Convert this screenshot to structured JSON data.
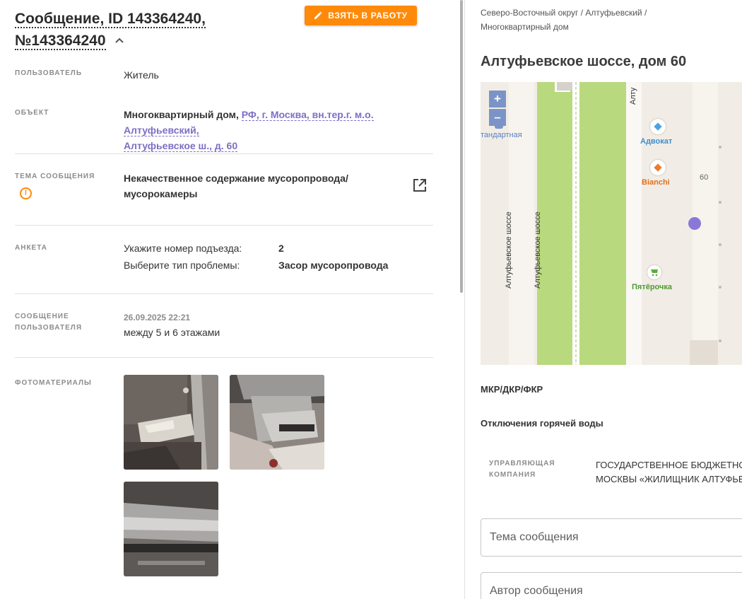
{
  "header": {
    "title_part1": "Сообщение, ID 143364240,",
    "title_part2": "№143364240",
    "work_button": "ВЗЯТЬ В РАБОТУ"
  },
  "fields": {
    "user_label": "ПОЛЬЗОВАТЕЛЬ",
    "user_value": "Житель",
    "object_label": "ОБЪЕКТ",
    "object_prefix": "Многоквартирный дом,",
    "object_link_1": "РФ, г. Москва, вн.тер.г. м.о. Алтуфьевский,",
    "object_link_2": "Алтуфьевское ш., д. 60",
    "topic_label": "ТЕМА СООБЩЕНИЯ",
    "topic_value_1": "Некачественное содержание мусоропровода/",
    "topic_value_2": "мусорокамеры",
    "form_label": "АНКЕТА",
    "form_q1": "Укажите номер подъезда:",
    "form_a1": "2",
    "form_q2": "Выберите тип проблемы:",
    "form_a2": "Засор мусоропровода",
    "msg_label_1": "СООБЩЕНИЕ",
    "msg_label_2": "ПОЛЬЗОВАТЕЛЯ",
    "msg_date": "26.09.2025 22:21",
    "msg_text": "между 5 и 6 этажами",
    "photos_label": "ФОТОМАТЕРИАЛЫ"
  },
  "right": {
    "breadcrumb_1": "Северо-Восточный округ / Алтуфьевский /",
    "breadcrumb_2": "Многоквартирный дом",
    "address": "Алтуфьевское шоссе, дом 60",
    "map": {
      "zoom_in": "+",
      "zoom_out": "–",
      "street_1": "Алтуфьевское шоссе",
      "street_2": "Алтуфьевское шоссе",
      "street_top": "Алту",
      "stop_label": "тандартная",
      "poi_1": "Адвокат",
      "poi_2": "Bianchi",
      "poi_3": "Пятёрочка",
      "house_number": "60"
    },
    "section_1": "МКР/ДКР/ФКР",
    "section_2": "Отключения горячей воды",
    "mc_label_1": "УПРАВЛЯЮЩАЯ",
    "mc_label_2": "КОМПАНИЯ",
    "mc_value_1": "ГОСУДАРСТВЕННОЕ БЮДЖЕТНОЕ",
    "mc_value_2": "МОСКВЫ «ЖИЛИЩНИК АЛТУФЬЕВСКИЙ",
    "topic_placeholder": "Тема сообщения",
    "author_placeholder": "Автор сообщения"
  },
  "colors": {
    "accent_orange": "#ff8a0a",
    "link_purple": "#7d6fc4",
    "map_green": "#b9d97f"
  }
}
